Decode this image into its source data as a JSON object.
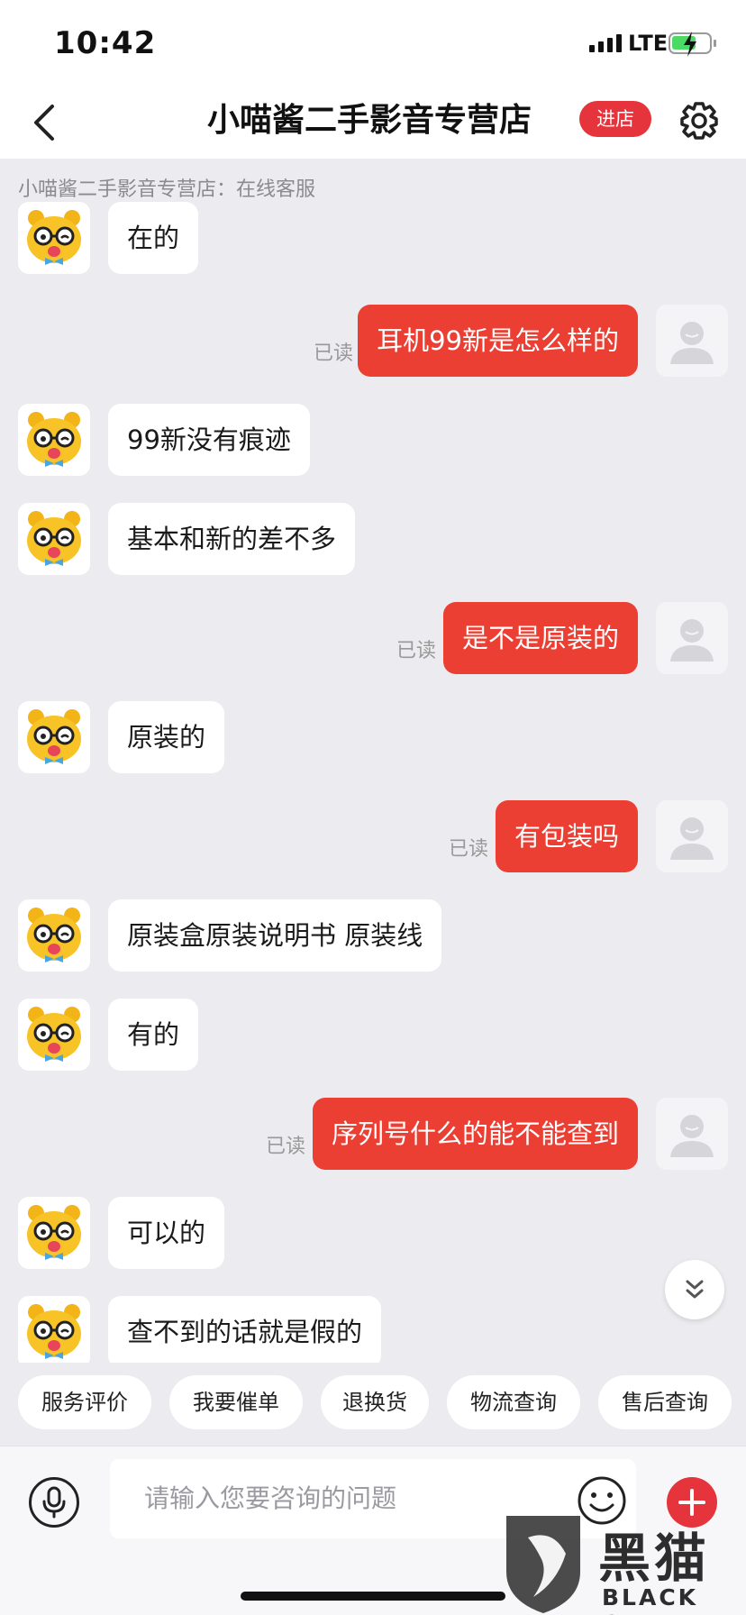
{
  "status_bar": {
    "time": "10:42",
    "network": "LTE"
  },
  "nav": {
    "title": "小喵酱二手影音专营店",
    "enter_store": "进店"
  },
  "chat": {
    "shop_label": "小喵酱二手影音专营店：在线客服",
    "read_label": "已读",
    "messages": [
      {
        "from": "shop",
        "text": "在的"
      },
      {
        "from": "user",
        "text": "耳机99新是怎么样的",
        "status": "已读"
      },
      {
        "from": "shop",
        "text": "99新没有痕迹"
      },
      {
        "from": "shop",
        "text": "基本和新的差不多"
      },
      {
        "from": "user",
        "text": "是不是原装的",
        "status": "已读"
      },
      {
        "from": "shop",
        "text": "原装的"
      },
      {
        "from": "user",
        "text": "有包装吗",
        "status": "已读"
      },
      {
        "from": "shop",
        "text": "原装盒原装说明书 原装线"
      },
      {
        "from": "shop",
        "text": "有的"
      },
      {
        "from": "user",
        "text": "序列号什么的能不能查到",
        "status": "已读"
      },
      {
        "from": "shop",
        "text": "可以的"
      },
      {
        "from": "shop",
        "text": "查不到的话就是假的"
      }
    ]
  },
  "quick_replies": [
    "服务评价",
    "我要催单",
    "退换货",
    "物流查询",
    "售后查询"
  ],
  "input": {
    "placeholder": "请输入您要咨询的问题"
  },
  "watermark": {
    "text": "黑猫",
    "sub": "BLACK CAT"
  },
  "colors": {
    "accent": "#e5343b",
    "user_bubble": "#ec3f33",
    "background": "#ececf0"
  },
  "icons": [
    "back-arrow-icon",
    "gear-icon",
    "chevron-double-down-icon",
    "microphone-icon",
    "emoji-icon",
    "plus-icon"
  ]
}
